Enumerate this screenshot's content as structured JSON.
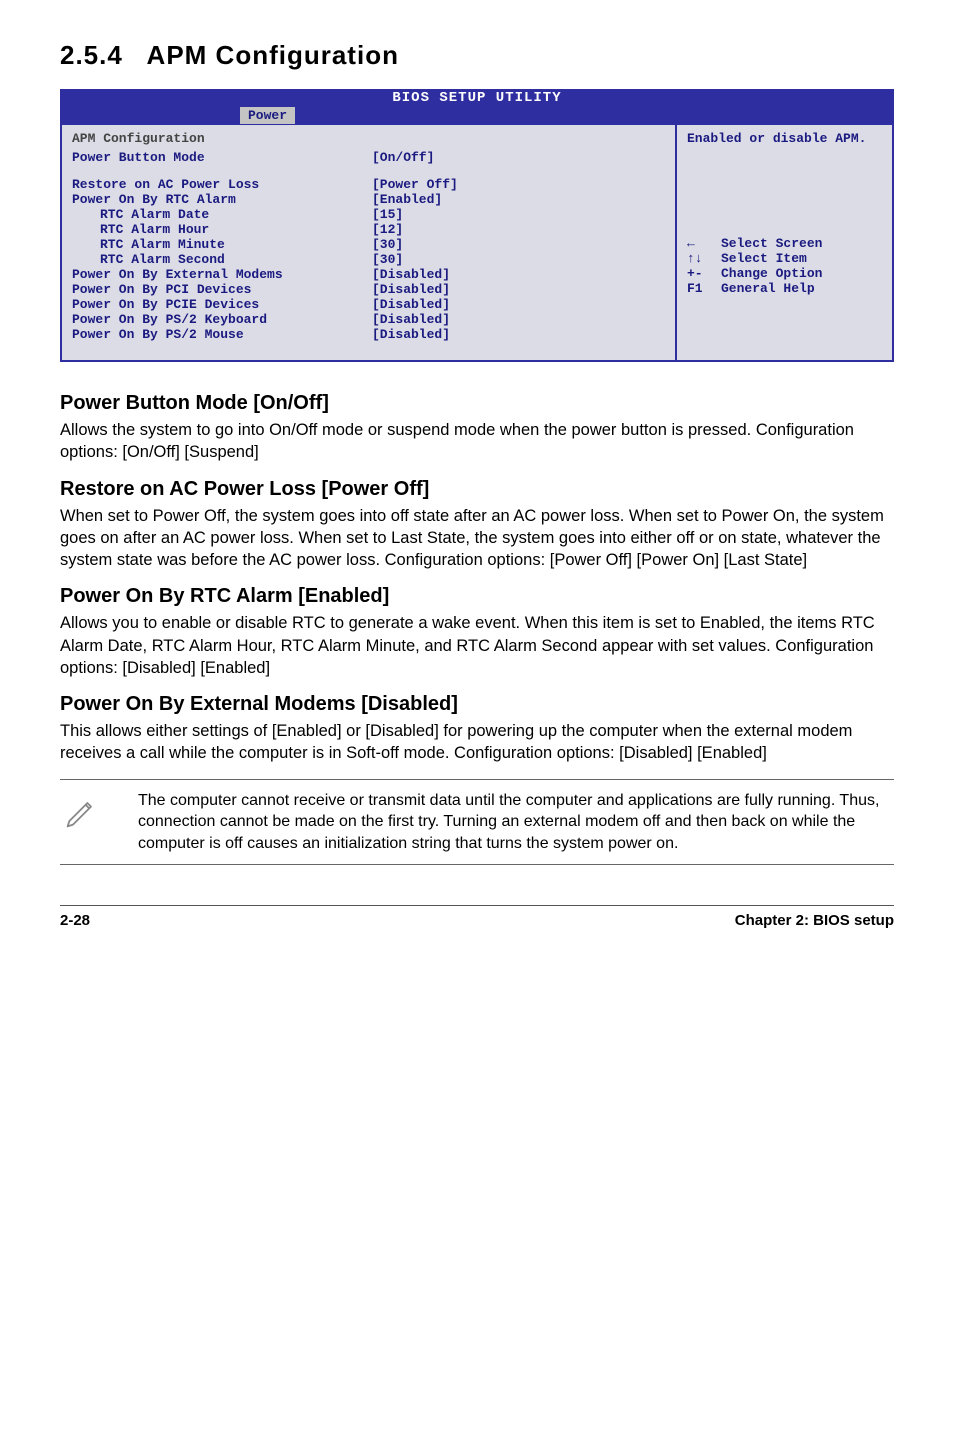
{
  "section": {
    "number": "2.5.4",
    "title": "APM Configuration"
  },
  "bios": {
    "utility_title": "BIOS SETUP UTILITY",
    "tab": "Power",
    "left_heading": "APM Configuration",
    "rows": [
      {
        "label": "Power Button Mode",
        "value": "[On/Off]",
        "indent": false,
        "gapAfter": true
      },
      {
        "label": "Restore on AC Power Loss",
        "value": "[Power Off]",
        "indent": false
      },
      {
        "label": "Power On By RTC Alarm",
        "value": "[Enabled]",
        "indent": false
      },
      {
        "label": "RTC Alarm Date",
        "value": "[15]",
        "indent": true
      },
      {
        "label": "RTC Alarm Hour",
        "value": "[12]",
        "indent": true
      },
      {
        "label": "RTC Alarm Minute",
        "value": "[30]",
        "indent": true
      },
      {
        "label": "RTC Alarm Second",
        "value": "[30]",
        "indent": true
      },
      {
        "label": "Power On By External Modems",
        "value": "[Disabled]",
        "indent": false
      },
      {
        "label": "Power On By PCI Devices",
        "value": "[Disabled]",
        "indent": false
      },
      {
        "label": "Power On By PCIE Devices",
        "value": "[Disabled]",
        "indent": false
      },
      {
        "label": "Power On By PS/2 Keyboard",
        "value": "[Disabled]",
        "indent": false
      },
      {
        "label": "Power On By PS/2 Mouse",
        "value": "[Disabled]",
        "indent": false
      }
    ],
    "help_text": "Enabled or disable APM.",
    "nav": [
      {
        "sym": "←",
        "text": "Select Screen"
      },
      {
        "sym": "↑↓",
        "text": "Select Item"
      },
      {
        "sym": "+-",
        "text": "Change Option"
      },
      {
        "sym": "F1",
        "text": "General Help"
      }
    ]
  },
  "subsections": [
    {
      "heading": "Power Button Mode [On/Off]",
      "body": "Allows the system to go into On/Off mode or suspend mode when the power button is pressed. Configuration options: [On/Off] [Suspend]"
    },
    {
      "heading": "Restore on AC Power Loss [Power Off]",
      "body": "When set to Power Off, the system goes into off state after an AC power loss. When set to Power On, the system goes on after an AC power loss. When set to Last State, the system goes into either off or on state, whatever the system state was before the AC power loss. Configuration options: [Power Off] [Power On] [Last State]"
    },
    {
      "heading": "Power On By RTC Alarm [Enabled]",
      "body": "Allows you to enable or disable RTC to generate a wake event. When this item is set to Enabled, the items RTC Alarm Date, RTC Alarm Hour, RTC Alarm Minute, and RTC Alarm Second appear with set values. Configuration options: [Disabled] [Enabled]"
    },
    {
      "heading": "Power On By External Modems [Disabled]",
      "body": "This allows either settings of [Enabled] or [Disabled] for powering up the computer when the external modem receives a call while the computer is in Soft-off mode. Configuration options: [Disabled] [Enabled]"
    }
  ],
  "note": "The computer cannot receive or transmit data until the computer and applications are fully running. Thus, connection cannot be made on the first try. Turning an external modem off and then back on while the computer is off causes an initialization string that turns the system power on.",
  "footer": {
    "left": "2-28",
    "right": "Chapter 2: BIOS setup"
  }
}
